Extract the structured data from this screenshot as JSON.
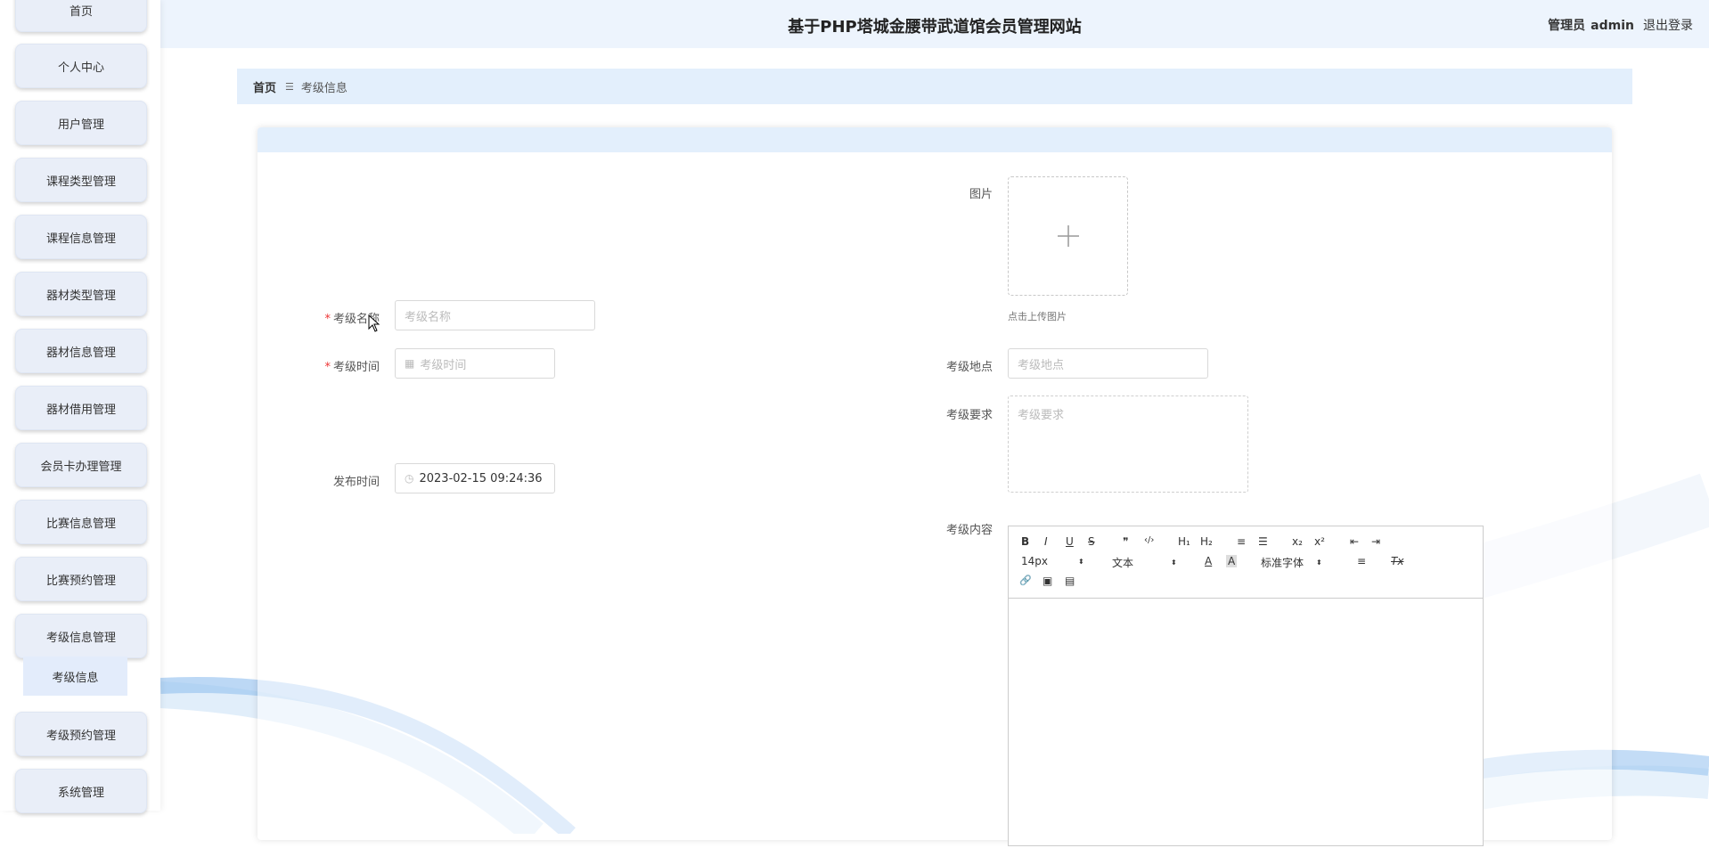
{
  "app": {
    "title": "基于PHP塔城金腰带武道馆会员管理网站",
    "user_role": "管理员",
    "username": "admin",
    "logout": "退出登录"
  },
  "sidebar": {
    "items": [
      {
        "label": "首页"
      },
      {
        "label": "个人中心"
      },
      {
        "label": "用户管理"
      },
      {
        "label": "课程类型管理"
      },
      {
        "label": "课程信息管理"
      },
      {
        "label": "器材类型管理"
      },
      {
        "label": "器材信息管理"
      },
      {
        "label": "器材借用管理"
      },
      {
        "label": "会员卡办理管理"
      },
      {
        "label": "比赛信息管理"
      },
      {
        "label": "比赛预约管理"
      },
      {
        "label": "考级信息管理"
      },
      {
        "label": "考级预约管理"
      },
      {
        "label": "系统管理"
      }
    ],
    "sub_item": {
      "label": "考级信息"
    }
  },
  "breadcrumb": {
    "home": "首页",
    "separator": "☰",
    "current": "考级信息"
  },
  "form": {
    "image_label": "图片",
    "upload_tip": "点击上传图片",
    "name_label": "考级名称",
    "name_placeholder": "考级名称",
    "time_label": "考级时间",
    "time_placeholder": "考级时间",
    "location_label": "考级地点",
    "location_placeholder": "考级地点",
    "requirement_label": "考级要求",
    "requirement_placeholder": "考级要求",
    "publish_label": "发布时间",
    "publish_value": "2023-02-15 09:24:36",
    "content_label": "考级内容"
  },
  "editor": {
    "font_size": "14px",
    "heading": "文本",
    "font_family": "标准字体",
    "buttons": {
      "bold": "B",
      "italic": "I",
      "underline": "U",
      "strike": "S",
      "quote": "❞",
      "code": "‹/›",
      "h1": "H₁",
      "h2": "H₂",
      "ol": "≡",
      "ul": "☰",
      "sub": "x₂",
      "sup": "x²",
      "outdent": "⇤",
      "indent": "⇥",
      "color": "A",
      "background": "A",
      "align": "≡",
      "clean": "Tx",
      "link": "🔗",
      "image": "▣",
      "video": "▤"
    }
  }
}
